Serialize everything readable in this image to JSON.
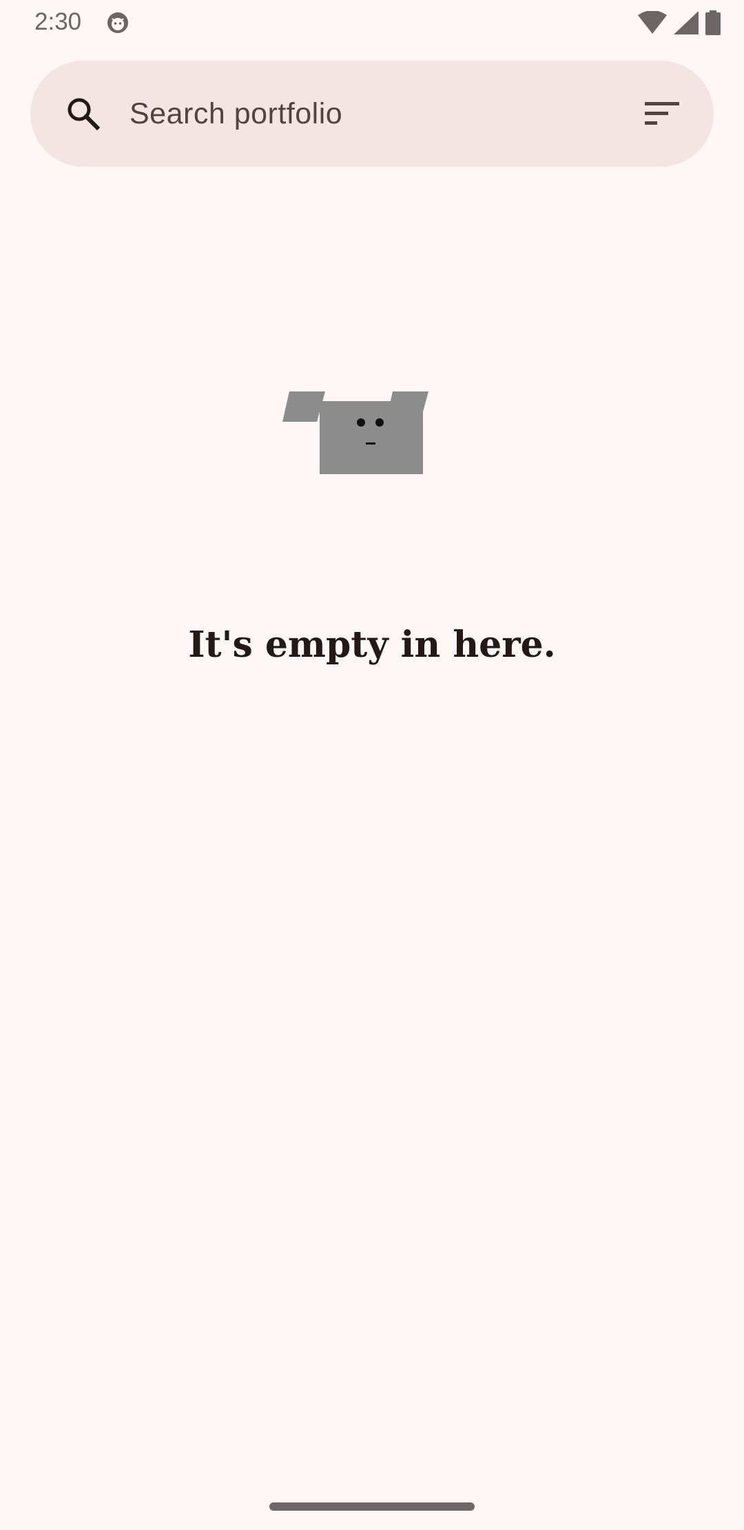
{
  "status_bar": {
    "time": "2:30",
    "icons": [
      "android-notification-icon",
      "wifi-icon",
      "signal-icon",
      "battery-icon"
    ]
  },
  "search": {
    "placeholder": "Search portfolio",
    "leading_icon": "search-icon",
    "trailing_icon": "sort-filter-icon"
  },
  "empty_state": {
    "illustration": "empty-box-icon",
    "title": "It's empty in here."
  },
  "colors": {
    "background": "#FFF7F5",
    "search_bar": "#F3E5E1",
    "text_primary": "#231917",
    "text_secondary": "#52433F",
    "illustration": "#8C8C8C"
  }
}
